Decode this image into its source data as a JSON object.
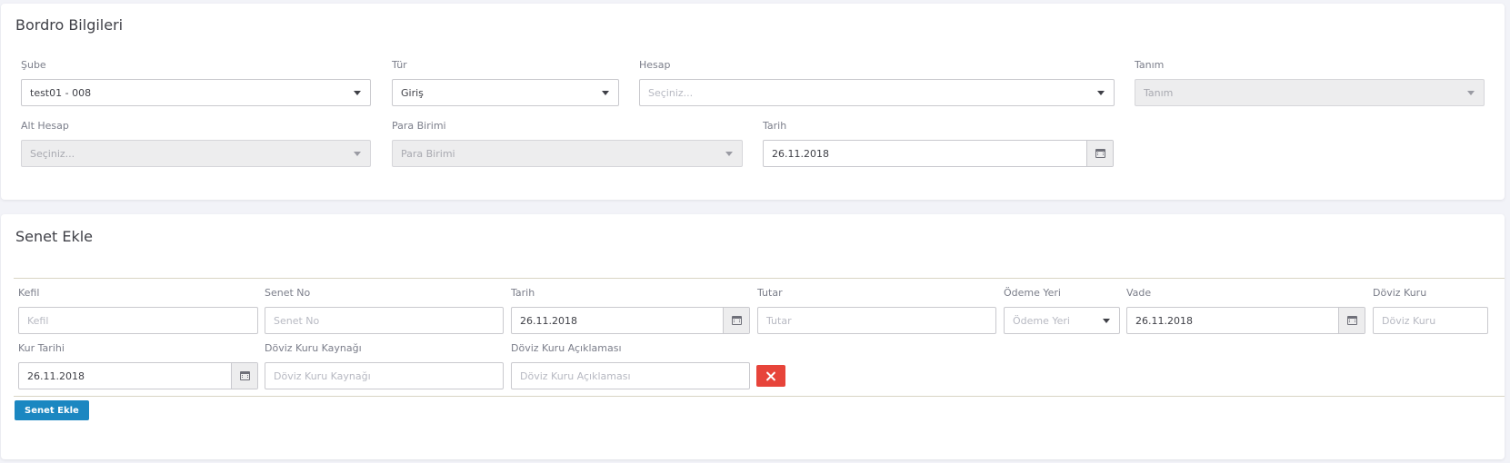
{
  "bordro": {
    "title": "Bordro Bilgileri",
    "sube": {
      "label": "Şube",
      "value": "test01 - 008"
    },
    "tur": {
      "label": "Tür",
      "value": "Giriş"
    },
    "hesap": {
      "label": "Hesap",
      "placeholder": "Seçiniz..."
    },
    "tanim": {
      "label": "Tanım",
      "placeholder": "Tanım"
    },
    "alt_hesap": {
      "label": "Alt Hesap",
      "placeholder": "Seçiniz..."
    },
    "para_birimi": {
      "label": "Para Birimi",
      "placeholder": "Para Birimi"
    },
    "tarih": {
      "label": "Tarih",
      "value": "26.11.2018"
    }
  },
  "senet": {
    "title": "Senet Ekle",
    "kefil": {
      "label": "Kefil",
      "placeholder": "Kefil"
    },
    "senet_no": {
      "label": "Senet No",
      "placeholder": "Senet No"
    },
    "tarih": {
      "label": "Tarih",
      "value": "26.11.2018"
    },
    "tutar": {
      "label": "Tutar",
      "placeholder": "Tutar"
    },
    "odeme_yeri": {
      "label": "Ödeme Yeri",
      "placeholder": "Ödeme Yeri"
    },
    "vade": {
      "label": "Vade",
      "value": "26.11.2018"
    },
    "doviz_kuru": {
      "label": "Döviz Kuru",
      "placeholder": "Döviz Kuru"
    },
    "kur_tarihi": {
      "label": "Kur Tarihi",
      "value": "26.11.2018"
    },
    "doviz_kuru_kaynagi": {
      "label": "Döviz Kuru Kaynağı",
      "placeholder": "Döviz Kuru Kaynağı"
    },
    "doviz_kuru_aciklamasi": {
      "label": "Döviz Kuru Açıklaması",
      "placeholder": "Döviz Kuru Açıklaması"
    },
    "add_button_label": "Senet Ekle"
  },
  "colors": {
    "primary_button": "#1b87c1",
    "delete_button": "#e7443a",
    "page_background": "#f2f3f8"
  },
  "icons": [
    "chevron-down-icon",
    "calendar-icon",
    "close-icon"
  ]
}
